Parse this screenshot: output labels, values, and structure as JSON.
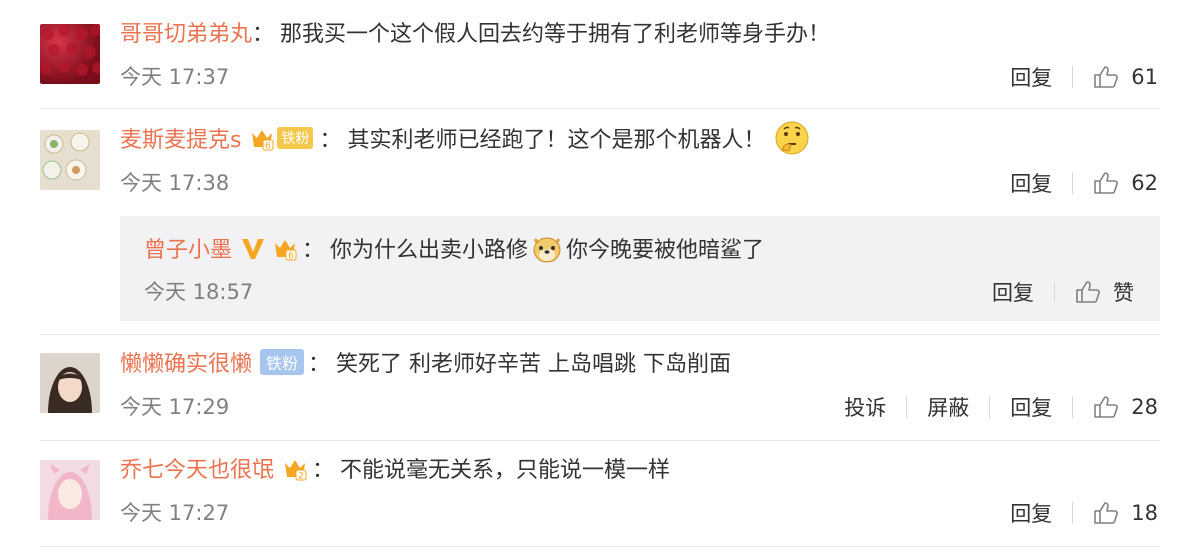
{
  "colors": {
    "username": "#eb7350",
    "text": "#333333",
    "meta": "#808080",
    "reply_bg": "#f2f2f5",
    "divider": "#e6e6e6"
  },
  "comments": [
    {
      "user": "哥哥切弟弟丸",
      "colon": "：",
      "text": "那我买一个这个假人回去约等于拥有了利老师等身手办！",
      "time": "今天 17:37",
      "reply": "回复",
      "likes": "61",
      "avatar_icon": "red-texture-avatar"
    },
    {
      "user": "麦斯麦提克s",
      "badge": "铁粉",
      "colon": "：",
      "text": "其实利老师已经跑了！这个是那个机器人！",
      "emoji": "thinking-face-emoji",
      "time": "今天 17:38",
      "reply": "回复",
      "likes": "62",
      "avatar_icon": "food-photo-avatar"
    },
    {
      "user": "懒懒确实很懒",
      "badge": "铁粉",
      "colon": "：",
      "text": "笑死了 利老师好辛苦 上岛唱跳 下岛削面",
      "time": "今天 17:29",
      "report": "投诉",
      "block": "屏蔽",
      "reply": "回复",
      "likes": "28",
      "avatar_icon": "girl-photo-avatar"
    },
    {
      "user": "乔七今天也很氓",
      "colon": "：",
      "text": "不能说毫无关系，只能说一模一样",
      "time": "今天 17:27",
      "reply": "回复",
      "likes": "18",
      "avatar_icon": "anime-girl-avatar"
    }
  ],
  "sub_reply": {
    "user": "曾子小墨",
    "colon": "：",
    "text_before": "你为什么出卖小路修",
    "text_after": "你今晚要被他暗鲨了",
    "emoji": "doge-emoji",
    "time": "今天 18:57",
    "reply": "回复",
    "like_label": "赞"
  }
}
